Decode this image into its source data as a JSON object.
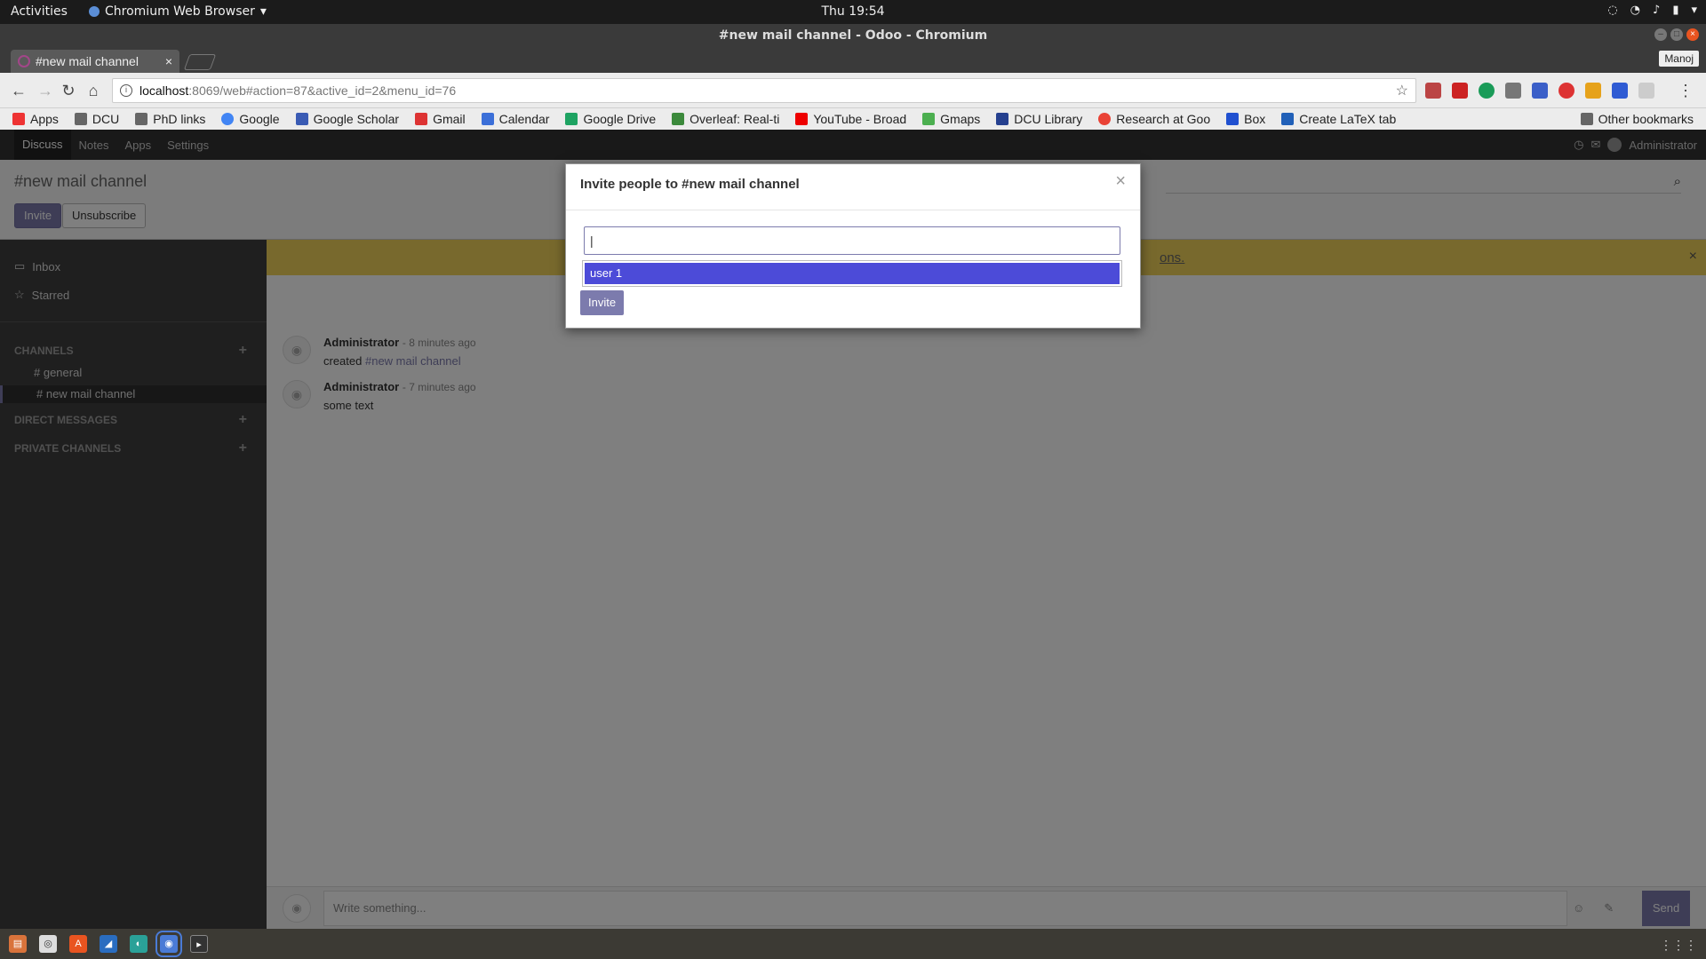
{
  "gnome": {
    "activities": "Activities",
    "app_name": "Chromium Web Browser",
    "clock": "Thu 19:54"
  },
  "browser": {
    "window_title": "#new mail channel - Odoo - Chromium",
    "tab_title": "#new mail channel",
    "profile": "Manoj",
    "url_host": "localhost",
    "url_path": ":8069/web#action=87&active_id=2&menu_id=76",
    "bookmarks": [
      "Apps",
      "DCU",
      "PhD links",
      "Google",
      "Google Scholar",
      "Gmail",
      "Calendar",
      "Google Drive",
      "Overleaf: Real-ti",
      "YouTube - Broad",
      "Gmaps",
      "DCU Library",
      "Research at Goo",
      "Box",
      "Create LaTeX tab"
    ],
    "other_bookmarks": "Other bookmarks",
    "more_glyph": "»"
  },
  "odoo": {
    "menu": [
      "Discuss",
      "Notes",
      "Apps",
      "Settings"
    ],
    "user": "Administrator",
    "breadcrumb": "#new mail channel",
    "invite_button": "Invite",
    "unsubscribe_button": "Unsubscribe",
    "sidebar": {
      "inbox": "Inbox",
      "starred": "Starred",
      "channels_header": "CHANNELS",
      "channels": [
        "general",
        "new mail channel"
      ],
      "direct_header": "DIRECT MESSAGES",
      "private_header": "PRIVATE CHANNELS"
    },
    "banner_link": "ons.",
    "messages": [
      {
        "author": "Administrator",
        "date": "- 8 minutes ago",
        "body_prefix": "created ",
        "body_link": "#new mail channel"
      },
      {
        "author": "Administrator",
        "date": "- 7 minutes ago",
        "body_prefix": "some text",
        "body_link": ""
      }
    ],
    "composer_placeholder": "Write something...",
    "send": "Send"
  },
  "modal": {
    "title": "Invite people to #new mail channel",
    "input_value": "|",
    "suggestion": "user 1",
    "invite_button": "Invite",
    "close": "×"
  },
  "colors": {
    "odoo_primary": "#7c7bad",
    "banner": "#f0d25a",
    "highlight": "#4c4bd8"
  }
}
